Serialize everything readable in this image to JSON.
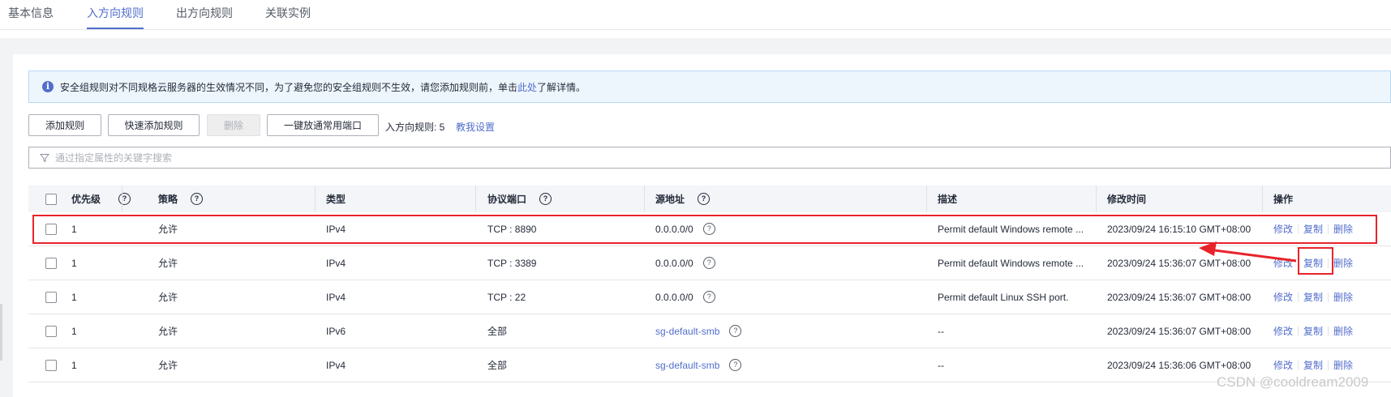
{
  "tabs": [
    {
      "label": "基本信息"
    },
    {
      "label": "入方向规则"
    },
    {
      "label": "出方向规则"
    },
    {
      "label": "关联实例"
    }
  ],
  "notice": {
    "text_before": "安全组规则对不同规格云服务器的生效情况不同，为了避免您的安全组规则不生效，请您添加规则前，单击",
    "link": "此处",
    "text_after": "了解详情。"
  },
  "toolbar": {
    "add_rule": "添加规则",
    "quick_add_rule": "快速添加规则",
    "delete": "删除",
    "open_common_ports": "一键放通常用端口",
    "rule_count_label": "入方向规则: 5",
    "help_link": "教我设置"
  },
  "search": {
    "placeholder": "通过指定属性的关键字搜索"
  },
  "table": {
    "headers": {
      "priority": "优先级",
      "policy": "策略",
      "type": "类型",
      "protocol_port": "协议端口",
      "source": "源地址",
      "description": "描述",
      "modified": "修改时间",
      "actions": "操作"
    },
    "actions": {
      "edit": "修改",
      "copy": "复制",
      "delete": "删除"
    },
    "rows": [
      {
        "priority": "1",
        "policy": "允许",
        "type": "IPv4",
        "port": "TCP : 8890",
        "source": "0.0.0.0/0",
        "source_is_link": false,
        "description": "Permit default Windows remote ...",
        "modified": "2023/09/24 16:15:10 GMT+08:00"
      },
      {
        "priority": "1",
        "policy": "允许",
        "type": "IPv4",
        "port": "TCP : 3389",
        "source": "0.0.0.0/0",
        "source_is_link": false,
        "description": "Permit default Windows remote ...",
        "modified": "2023/09/24 15:36:07 GMT+08:00"
      },
      {
        "priority": "1",
        "policy": "允许",
        "type": "IPv4",
        "port": "TCP : 22",
        "source": "0.0.0.0/0",
        "source_is_link": false,
        "description": "Permit default Linux SSH port.",
        "modified": "2023/09/24 15:36:07 GMT+08:00"
      },
      {
        "priority": "1",
        "policy": "允许",
        "type": "IPv6",
        "port": "全部",
        "source": "sg-default-smb",
        "source_is_link": true,
        "description": "--",
        "modified": "2023/09/24 15:36:07 GMT+08:00"
      },
      {
        "priority": "1",
        "policy": "允许",
        "type": "IPv4",
        "port": "全部",
        "source": "sg-default-smb",
        "source_is_link": true,
        "description": "--",
        "modified": "2023/09/24 15:36:06 GMT+08:00"
      }
    ]
  },
  "watermark": "CSDN @cooldream2009",
  "colors": {
    "accent": "#526ecc",
    "annotation": "#e8232a"
  }
}
